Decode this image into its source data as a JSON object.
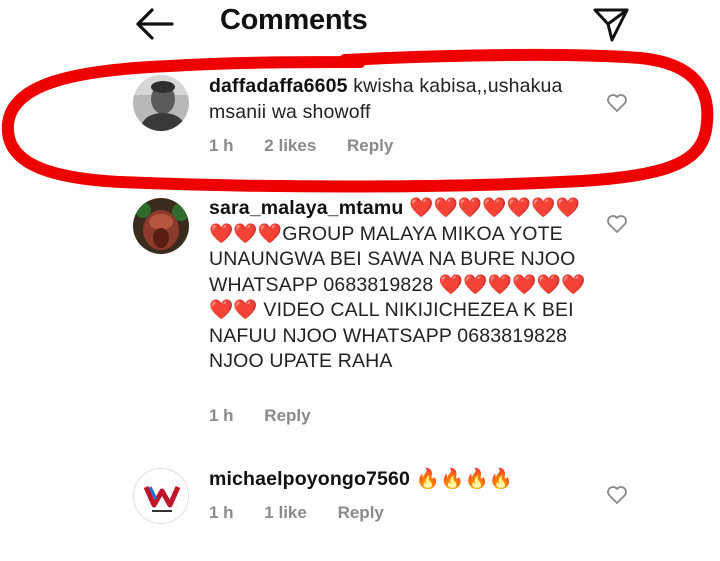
{
  "header": {
    "title": "Comments",
    "back_icon": "arrow-left-icon",
    "share_icon": "paper-plane-icon"
  },
  "comments": [
    {
      "username": "daffadaffa6605",
      "text": "kwisha kabisa,,ushakua msanii wa showoff",
      "time": "1 h",
      "likes": "2 likes",
      "reply": "Reply"
    },
    {
      "username": "sara_malaya_mtamu",
      "text": "❤️❤️❤️❤️❤️❤️❤️❤️❤️❤️GROUP MALAYA MIKOA YOTE UNAUNGWA BEI SAWA NA BURE NJOO WHATSAPP 0683819828  ❤️❤️❤️❤️❤️❤️❤️❤️ VIDEO CALL NIKIJICHEZEA K BEI NAFUU NJOO WHATSAPP 0683819828  NJOO UPATE RAHA",
      "time": "1 h",
      "reply": "Reply"
    },
    {
      "username": "michaelpoyongo7560",
      "text": "🔥🔥🔥🔥",
      "time": "1 h",
      "likes": "1 like",
      "reply": "Reply"
    }
  ],
  "colors": {
    "annotation_red": "#ee0000",
    "meta_gray": "#8a8a8a"
  }
}
